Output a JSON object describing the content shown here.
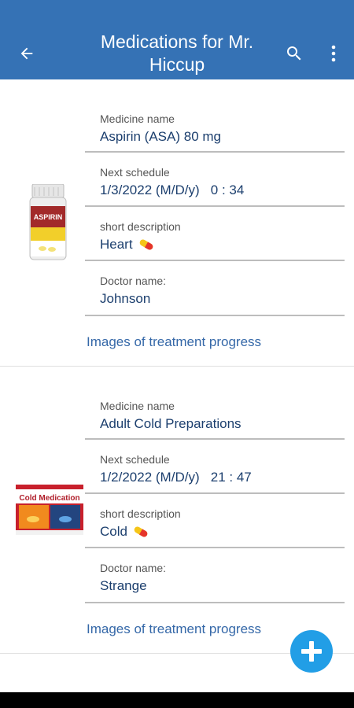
{
  "appbar": {
    "title": "Medications for Mr. Hiccup",
    "back_icon": "arrow-back-icon",
    "search_icon": "search-icon",
    "menu_icon": "more-vert-icon"
  },
  "labels": {
    "medicine_name": "Medicine name",
    "next_schedule": "Next schedule",
    "short_description": "short description",
    "doctor_name": "Doctor name:",
    "images_link": "Images of treatment progress"
  },
  "medications": [
    {
      "medicine_name": "Aspirin (ASA) 80 mg",
      "next_schedule": "1/3/2022 (M/D/y)   0 : 34",
      "short_description": "Heart",
      "doctor_name": "Johnson",
      "image": "aspirin-bottle"
    },
    {
      "medicine_name": "Adult Cold Preparations",
      "next_schedule": "1/2/2022 (M/D/y)   21 : 47",
      "short_description": "Cold",
      "doctor_name": "Strange",
      "image": "cold-medication-box"
    }
  ],
  "product_art": {
    "aspirin_brand": "ASPIRIN",
    "cold_brand": "Cold Medication"
  },
  "fab_icon": "add-icon",
  "colors": {
    "appbar": "#3572b5",
    "fab": "#229ee6",
    "value_text": "#1c3f6e",
    "link": "#3568a8"
  }
}
